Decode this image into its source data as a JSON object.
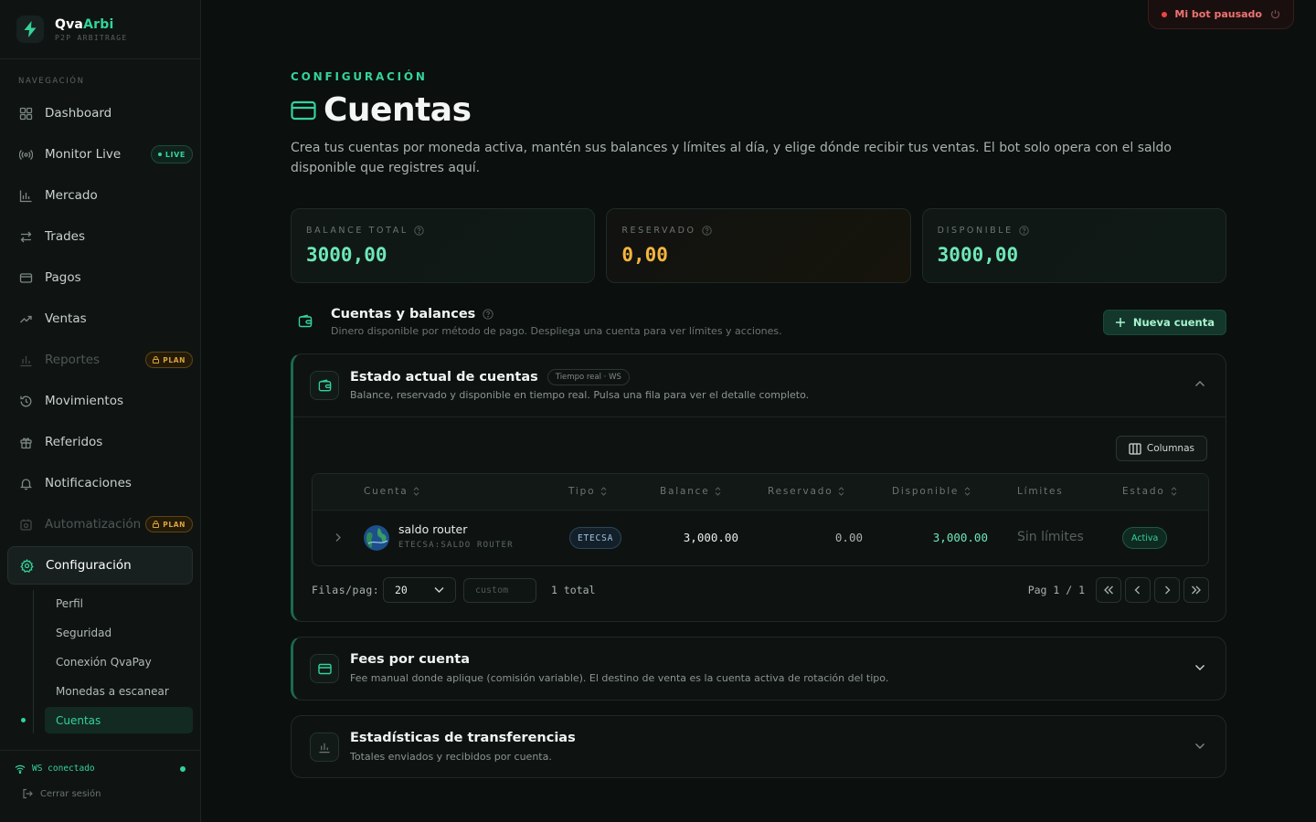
{
  "brand": {
    "name_a": "Qva",
    "name_b": "Arbi",
    "subtitle": "P2P ARBITRAGE"
  },
  "sidebar": {
    "section": "NAVEGACIÓN",
    "items": [
      {
        "label": "Dashboard",
        "icon": "dashboard-icon"
      },
      {
        "label": "Monitor Live",
        "icon": "radio-icon",
        "badge": "LIVE"
      },
      {
        "label": "Mercado",
        "icon": "market-chart-icon"
      },
      {
        "label": "Trades",
        "icon": "swap-icon"
      },
      {
        "label": "Pagos",
        "icon": "card-icon"
      },
      {
        "label": "Ventas",
        "icon": "trend-icon"
      },
      {
        "label": "Reportes",
        "icon": "bar-chart-icon",
        "badge": "PLAN"
      },
      {
        "label": "Movimientos",
        "icon": "history-icon"
      },
      {
        "label": "Referidos",
        "icon": "gift-icon"
      },
      {
        "label": "Notificaciones",
        "icon": "bell-icon"
      },
      {
        "label": "Automatización",
        "icon": "automation-icon",
        "badge": "PLAN"
      },
      {
        "label": "Configuración",
        "icon": "gear-icon"
      }
    ],
    "subitems": [
      "Perfil",
      "Seguridad",
      "Conexión QvaPay",
      "Monedas a escanear",
      "Cuentas"
    ],
    "ws_status": "WS conectado",
    "logout": "Cerrar sesión"
  },
  "topbar": {
    "bot_status": "Mi bot pausado"
  },
  "page": {
    "eyebrow": "CONFIGURACIÓN",
    "title": "Cuentas",
    "description": "Crea tus cuentas por moneda activa, mantén sus balances y límites al día, y elige dónde recibir tus ventas. El bot solo opera con el saldo disponible que registres aquí."
  },
  "stats": [
    {
      "label": "BALANCE TOTAL",
      "value": "3000,00"
    },
    {
      "label": "RESERVADO",
      "value": "0,00"
    },
    {
      "label": "DISPONIBLE",
      "value": "3000,00"
    }
  ],
  "section": {
    "title": "Cuentas y balances",
    "subtitle": "Dinero disponible por método de pago. Despliega una cuenta para ver límites y acciones.",
    "new_button": "Nueva cuenta"
  },
  "panel_estado": {
    "title": "Estado actual de cuentas",
    "tag": "Tiempo real · WS",
    "subtitle": "Balance, reservado y disponible en tiempo real. Pulsa una fila para ver el detalle completo.",
    "columns_button": "Columnas",
    "headers": [
      "Cuenta",
      "Tipo",
      "Balance",
      "Reservado",
      "Disponible",
      "Límites",
      "Estado"
    ],
    "rows": [
      {
        "name": "saldo router",
        "sub": "ETECSA:SALDO ROUTER",
        "tipo": "ETECSA",
        "balance": "3,000.00",
        "reservado": "0.00",
        "disponible": "3,000.00",
        "limites": "Sin límites",
        "estado": "Activa"
      }
    ],
    "pager": {
      "rows_label": "Filas/pag:",
      "rows_value": "20",
      "custom_placeholder": "custom",
      "total": "1 total",
      "page": "Pag 1 / 1"
    }
  },
  "panel_fees": {
    "title": "Fees por cuenta",
    "subtitle": "Fee manual donde aplique (comisión variable). El destino de venta es la cuenta activa de rotación del tipo."
  },
  "panel_stats": {
    "title": "Estadísticas de transferencias",
    "subtitle": "Totales enviados y recibidos por cuenta."
  }
}
